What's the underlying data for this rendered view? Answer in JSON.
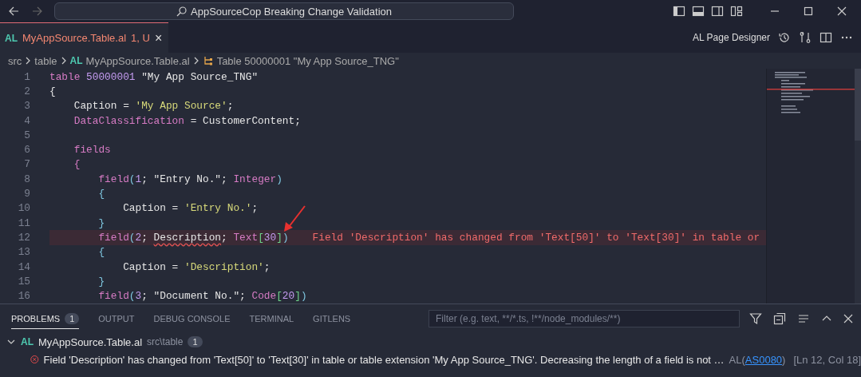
{
  "title_bar": {
    "search_text": "AppSourceCop Breaking Change Validation"
  },
  "editor_tabs": [
    {
      "lang": "AL",
      "label": "MyAppSource.Table.al",
      "badge": "1, U",
      "close": "×",
      "selected": true,
      "has_error": true
    }
  ],
  "editor_actions": {
    "label": "AL Page Designer"
  },
  "breadcrumb": [
    {
      "kind": "text",
      "label": "src"
    },
    {
      "kind": "text",
      "label": "table"
    },
    {
      "kind": "file",
      "lang": "AL",
      "label": "MyAppSource.Table.al"
    },
    {
      "kind": "symbol",
      "label": "Table 50000001 \"My App Source_TNG\""
    }
  ],
  "code_lines": [
    {
      "number": "1",
      "error": false,
      "tokens": [
        {
          "kind": "keyword",
          "text": "table "
        },
        {
          "kind": "number",
          "text": "50000001"
        },
        {
          "kind": "plain",
          "text": " \"My App Source_TNG\""
        }
      ]
    },
    {
      "number": "2",
      "error": false,
      "tokens": [
        {
          "kind": "plain",
          "text": "{"
        }
      ],
      "children": [
        {
          "number": "3",
          "error": false,
          "tokens": [
            {
              "kind": "plain",
              "text": "Caption = "
            },
            {
              "kind": "string",
              "text": "'My App Source'"
            },
            {
              "kind": "plain",
              "text": ";"
            }
          ]
        },
        {
          "number": "4",
          "error": false,
          "tokens": [
            {
              "kind": "keyword",
              "text": "DataClassification"
            },
            {
              "kind": "plain",
              "text": " = CustomerContent;"
            }
          ]
        },
        {
          "number": "5",
          "error": false
        },
        {
          "number": "6",
          "error": false,
          "tokens": [
            {
              "kind": "keyword",
              "text": "fields"
            }
          ]
        },
        {
          "number": "7",
          "error": false,
          "tokens": [
            {
              "kind": "keyword",
              "text": "{"
            }
          ],
          "children": [
            {
              "number": "8",
              "error": false,
              "tokens": [
                {
                  "kind": "keyword",
                  "text": "field"
                },
                {
                  "kind": "bracket",
                  "text": "("
                },
                {
                  "kind": "number",
                  "text": "1"
                },
                {
                  "kind": "plain",
                  "text": "; \"Entry No.\"; "
                },
                {
                  "kind": "keyword",
                  "text": "Integer"
                },
                {
                  "kind": "bracket",
                  "text": ")"
                }
              ]
            },
            {
              "number": "9",
              "error": false,
              "tokens": [
                {
                  "kind": "bracket",
                  "text": "{"
                }
              ],
              "children": [
                {
                  "number": "10",
                  "error": false,
                  "tokens": [
                    {
                      "kind": "plain",
                      "text": "Caption = "
                    },
                    {
                      "kind": "string",
                      "text": "'Entry No.'"
                    },
                    {
                      "kind": "plain",
                      "text": ";"
                    }
                  ]
                }
              ]
            },
            {
              "number": "11",
              "error": false,
              "tokens": [
                {
                  "kind": "bracket",
                  "text": "}"
                }
              ]
            },
            {
              "number": "12",
              "error": true,
              "tokens": [
                {
                  "kind": "keyword",
                  "text": "field"
                },
                {
                  "kind": "bracket",
                  "text": "("
                },
                {
                  "kind": "number",
                  "text": "2"
                },
                {
                  "kind": "plain",
                  "text": "; "
                },
                {
                  "kind": "squiggle",
                  "text": "Description"
                },
                {
                  "kind": "plain",
                  "text": "; "
                },
                {
                  "kind": "keyword",
                  "text": "Text"
                },
                {
                  "kind": "bracket2",
                  "text": "["
                },
                {
                  "kind": "number",
                  "text": "30"
                },
                {
                  "kind": "bracket2",
                  "text": "]"
                },
                {
                  "kind": "bracket",
                  "text": ")"
                }
              ],
              "inline_message": "Field 'Description' has changed from 'Text[50]' to 'Text[30]' in table or"
            },
            {
              "number": "13",
              "error": false,
              "tokens": [
                {
                  "kind": "bracket",
                  "text": "{"
                }
              ],
              "children": [
                {
                  "number": "14",
                  "error": false,
                  "tokens": [
                    {
                      "kind": "plain",
                      "text": "Caption = "
                    },
                    {
                      "kind": "string",
                      "text": "'Description'"
                    },
                    {
                      "kind": "plain",
                      "text": ";"
                    }
                  ]
                }
              ]
            },
            {
              "number": "15",
              "error": false,
              "tokens": [
                {
                  "kind": "bracket",
                  "text": "}"
                }
              ]
            },
            {
              "number": "16",
              "error": false,
              "tokens": [
                {
                  "kind": "keyword",
                  "text": "field"
                },
                {
                  "kind": "bracket",
                  "text": "("
                },
                {
                  "kind": "number",
                  "text": "3"
                },
                {
                  "kind": "plain",
                  "text": "; \"Document No.\"; "
                },
                {
                  "kind": "keyword",
                  "text": "Code"
                },
                {
                  "kind": "bracket2",
                  "text": "["
                },
                {
                  "kind": "number",
                  "text": "20"
                },
                {
                  "kind": "bracket2",
                  "text": "]"
                },
                {
                  "kind": "bracket",
                  "text": ")"
                }
              ]
            }
          ]
        }
      ]
    }
  ],
  "panel": {
    "tabs": [
      {
        "label": "PROBLEMS",
        "badge": "1",
        "selected": true
      },
      {
        "label": "OUTPUT",
        "selected": false
      },
      {
        "label": "DEBUG CONSOLE",
        "selected": false
      },
      {
        "label": "TERMINAL",
        "selected": false
      },
      {
        "label": "GITLENS",
        "selected": false
      }
    ],
    "filter": {
      "placeholder": "Filter (e.g. text, **/*.ts, !**/node_modules/**)"
    },
    "problem_groups": [
      {
        "expanded": true,
        "lang": "AL",
        "file": "MyAppSource.Table.al",
        "path": "src\\table",
        "count": "1",
        "problems": [
          {
            "message": "Field 'Description' has changed from 'Text[50]' to 'Text[30]' in table or table extension 'My App Source_TNG'. Decreasing the length of a field is not …",
            "source_open": "AL(",
            "code": "AS0080",
            "source_close": ")",
            "location": "[Ln 12, Col 18]"
          }
        ]
      }
    ]
  }
}
